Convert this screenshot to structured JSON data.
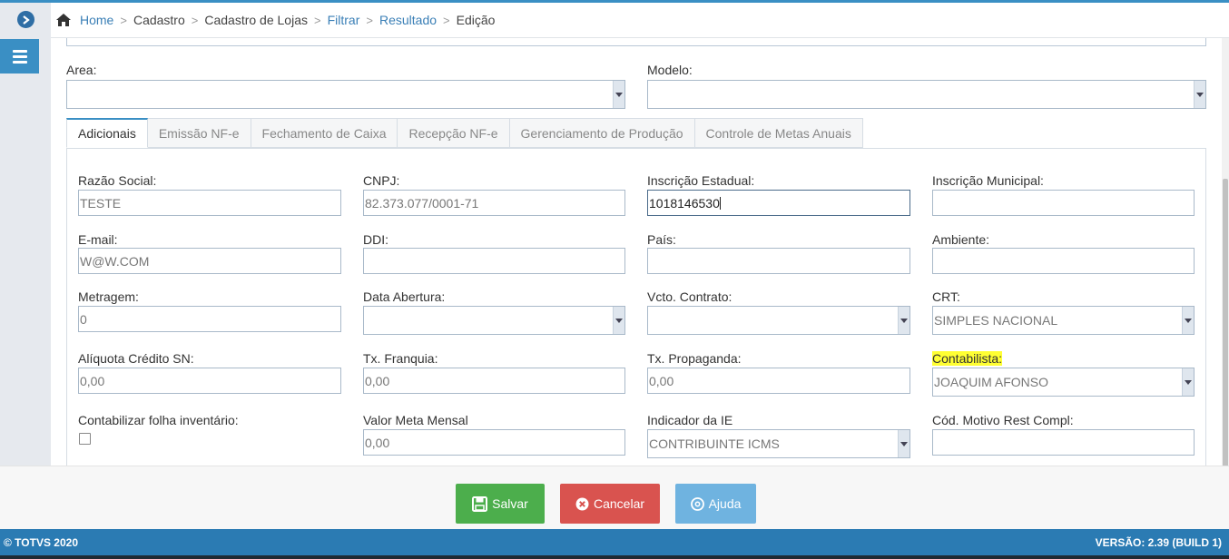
{
  "breadcrumb": {
    "items": [
      {
        "label": "Home",
        "link": true
      },
      {
        "label": "Cadastro",
        "link": false
      },
      {
        "label": "Cadastro de Lojas",
        "link": false
      },
      {
        "label": "Filtrar",
        "link": true
      },
      {
        "label": "Resultado",
        "link": true
      },
      {
        "label": "Edição",
        "link": false
      }
    ],
    "separator": ">"
  },
  "top_fields": {
    "area": {
      "label": "Area:",
      "value": ""
    },
    "modelo": {
      "label": "Modelo:",
      "value": ""
    }
  },
  "tabs": [
    {
      "label": "Adicionais",
      "active": true
    },
    {
      "label": "Emissão NF-e",
      "active": false
    },
    {
      "label": "Fechamento de Caixa",
      "active": false
    },
    {
      "label": "Recepção NF-e",
      "active": false
    },
    {
      "label": "Gerenciamento de Produção",
      "active": false
    },
    {
      "label": "Controle de Metas Anuais",
      "active": false
    }
  ],
  "form": {
    "razao_social": {
      "label": "Razão Social:",
      "value": "TESTE"
    },
    "cnpj": {
      "label": "CNPJ:",
      "value": "82.373.077/0001-71"
    },
    "inscricao_estadual": {
      "label": "Inscrição Estadual:",
      "value": "1018146530"
    },
    "inscricao_municipal": {
      "label": "Inscrição Municipal:",
      "value": ""
    },
    "email": {
      "label": "E-mail:",
      "value": "W@W.COM"
    },
    "ddi": {
      "label": "DDI:",
      "value": ""
    },
    "pais": {
      "label": "País:",
      "value": ""
    },
    "ambiente": {
      "label": "Ambiente:",
      "value": ""
    },
    "metragem": {
      "label": "Metragem:",
      "value": "0"
    },
    "data_abertura": {
      "label": "Data Abertura:",
      "value": ""
    },
    "vcto_contrato": {
      "label": "Vcto. Contrato:",
      "value": ""
    },
    "crt": {
      "label": "CRT:",
      "value": "SIMPLES NACIONAL"
    },
    "aliquota_credito_sn": {
      "label": "Alíquota Crédito SN:",
      "value": "0,00"
    },
    "tx_franquia": {
      "label": "Tx. Franquia:",
      "value": "0,00"
    },
    "tx_propaganda": {
      "label": "Tx. Propaganda:",
      "value": "0,00"
    },
    "contabilista": {
      "label": "Contabilista:",
      "value": "JOAQUIM AFONSO"
    },
    "contabilizar_folha": {
      "label": "Contabilizar folha inventário:",
      "checked": false
    },
    "valor_meta_mensal": {
      "label": "Valor Meta Mensal",
      "value": "0,00"
    },
    "indicador_ie": {
      "label": "Indicador da IE",
      "value": "CONTRIBUINTE ICMS"
    },
    "cod_motivo_rest_compl": {
      "label": "Cód. Motivo Rest Compl:",
      "value": ""
    }
  },
  "buttons": {
    "save": "Salvar",
    "cancel": "Cancelar",
    "help": "Ajuda"
  },
  "footer": {
    "copyright": "© TOTVS 2020",
    "version": "VERSÃO: 2.39 (BUILD 1)"
  },
  "colors": {
    "accent": "#3a8fc4",
    "save": "#4cae4c",
    "cancel": "#d9534f",
    "help": "#6fb3e0",
    "highlight": "#ffff33"
  }
}
